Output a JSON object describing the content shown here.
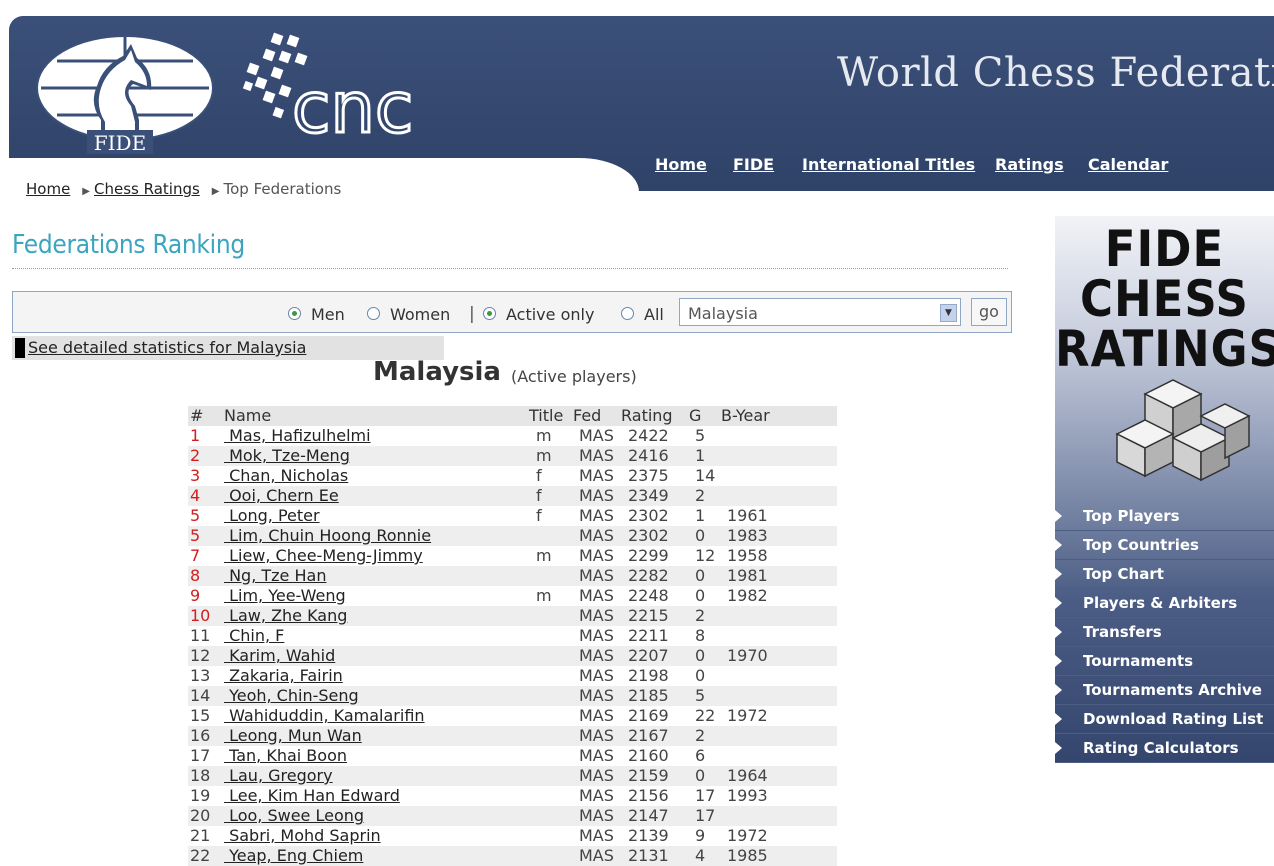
{
  "header": {
    "fide_logo_text": "FIDE",
    "cnc_logo_text": "cnc",
    "site_title": "World Chess Federation",
    "nav": [
      "Home",
      "FIDE",
      "International Titles",
      "Ratings",
      "Calendar"
    ]
  },
  "breadcrumb": [
    "Home",
    "Chess Ratings",
    "Top Federations"
  ],
  "page_title": "Federations Ranking",
  "filters": {
    "gender_options": [
      "Men",
      "Women"
    ],
    "gender_selected": "Men",
    "separator": "|",
    "activity_options": [
      "Active only",
      "All"
    ],
    "activity_selected": "Active only",
    "federation_value": "Malaysia",
    "go_label": "go"
  },
  "stats_link": "See detailed statistics for Malaysia",
  "country": {
    "name": "Malaysia",
    "subtitle": "(Active players)"
  },
  "table": {
    "headers": [
      "#",
      "Name",
      "Title",
      "Fed",
      "Rating",
      "G",
      "B-Year"
    ],
    "rows": [
      {
        "rank": "1",
        "name": "Mas, Hafizulhelmi",
        "title": "m",
        "fed": "MAS",
        "rating": "2422",
        "games": "5",
        "byear": "",
        "red": true
      },
      {
        "rank": "2",
        "name": "Mok, Tze-Meng",
        "title": "m",
        "fed": "MAS",
        "rating": "2416",
        "games": "1",
        "byear": "",
        "red": true
      },
      {
        "rank": "3",
        "name": "Chan, Nicholas",
        "title": "f",
        "fed": "MAS",
        "rating": "2375",
        "games": "14",
        "byear": "",
        "red": true
      },
      {
        "rank": "4",
        "name": "Ooi, Chern Ee",
        "title": "f",
        "fed": "MAS",
        "rating": "2349",
        "games": "2",
        "byear": "",
        "red": true
      },
      {
        "rank": "5",
        "name": "Long, Peter",
        "title": "f",
        "fed": "MAS",
        "rating": "2302",
        "games": "1",
        "byear": "1961",
        "red": true
      },
      {
        "rank": "5",
        "name": "Lim, Chuin Hoong Ronnie",
        "title": "",
        "fed": "MAS",
        "rating": "2302",
        "games": "0",
        "byear": "1983",
        "red": true
      },
      {
        "rank": "7",
        "name": "Liew, Chee-Meng-Jimmy",
        "title": "m",
        "fed": "MAS",
        "rating": "2299",
        "games": "12",
        "byear": "1958",
        "red": true
      },
      {
        "rank": "8",
        "name": "Ng, Tze Han",
        "title": "",
        "fed": "MAS",
        "rating": "2282",
        "games": "0",
        "byear": "1981",
        "red": true
      },
      {
        "rank": "9",
        "name": "Lim, Yee-Weng",
        "title": "m",
        "fed": "MAS",
        "rating": "2248",
        "games": "0",
        "byear": "1982",
        "red": true
      },
      {
        "rank": "10",
        "name": "Law, Zhe Kang",
        "title": "",
        "fed": "MAS",
        "rating": "2215",
        "games": "2",
        "byear": "",
        "red": true
      },
      {
        "rank": "11",
        "name": "Chin, F",
        "title": "",
        "fed": "MAS",
        "rating": "2211",
        "games": "8",
        "byear": "",
        "red": false
      },
      {
        "rank": "12",
        "name": "Karim, Wahid",
        "title": "",
        "fed": "MAS",
        "rating": "2207",
        "games": "0",
        "byear": "1970",
        "red": false
      },
      {
        "rank": "13",
        "name": "Zakaria, Fairin",
        "title": "",
        "fed": "MAS",
        "rating": "2198",
        "games": "0",
        "byear": "",
        "red": false
      },
      {
        "rank": "14",
        "name": "Yeoh, Chin-Seng",
        "title": "",
        "fed": "MAS",
        "rating": "2185",
        "games": "5",
        "byear": "",
        "red": false
      },
      {
        "rank": "15",
        "name": "Wahiduddin, Kamalarifin",
        "title": "",
        "fed": "MAS",
        "rating": "2169",
        "games": "22",
        "byear": "1972",
        "red": false
      },
      {
        "rank": "16",
        "name": "Leong, Mun Wan",
        "title": "",
        "fed": "MAS",
        "rating": "2167",
        "games": "2",
        "byear": "",
        "red": false
      },
      {
        "rank": "17",
        "name": "Tan, Khai Boon",
        "title": "",
        "fed": "MAS",
        "rating": "2160",
        "games": "6",
        "byear": "",
        "red": false
      },
      {
        "rank": "18",
        "name": "Lau, Gregory",
        "title": "",
        "fed": "MAS",
        "rating": "2159",
        "games": "0",
        "byear": "1964",
        "red": false
      },
      {
        "rank": "19",
        "name": "Lee, Kim Han Edward",
        "title": "",
        "fed": "MAS",
        "rating": "2156",
        "games": "17",
        "byear": "1993",
        "red": false
      },
      {
        "rank": "20",
        "name": "Loo, Swee Leong",
        "title": "",
        "fed": "MAS",
        "rating": "2147",
        "games": "17",
        "byear": "",
        "red": false
      },
      {
        "rank": "21",
        "name": "Sabri, Mohd Saprin",
        "title": "",
        "fed": "MAS",
        "rating": "2139",
        "games": "9",
        "byear": "1972",
        "red": false
      },
      {
        "rank": "22",
        "name": "Yeap, Eng Chiem",
        "title": "",
        "fed": "MAS",
        "rating": "2131",
        "games": "4",
        "byear": "1985",
        "red": false
      }
    ]
  },
  "sidebar": {
    "promo_lines": [
      "FIDE",
      "CHESS",
      "RATINGS"
    ],
    "menu": [
      "Top Players",
      "Top Countries",
      "Top Chart",
      "Players & Arbiters",
      "Transfers",
      "Tournaments",
      "Tournaments Archive",
      "Download Rating List",
      "Rating Calculators"
    ]
  },
  "colors": {
    "banner": "#34476f",
    "title_accent": "#3ca5c0",
    "top_rank_red": "#d21e1e"
  }
}
